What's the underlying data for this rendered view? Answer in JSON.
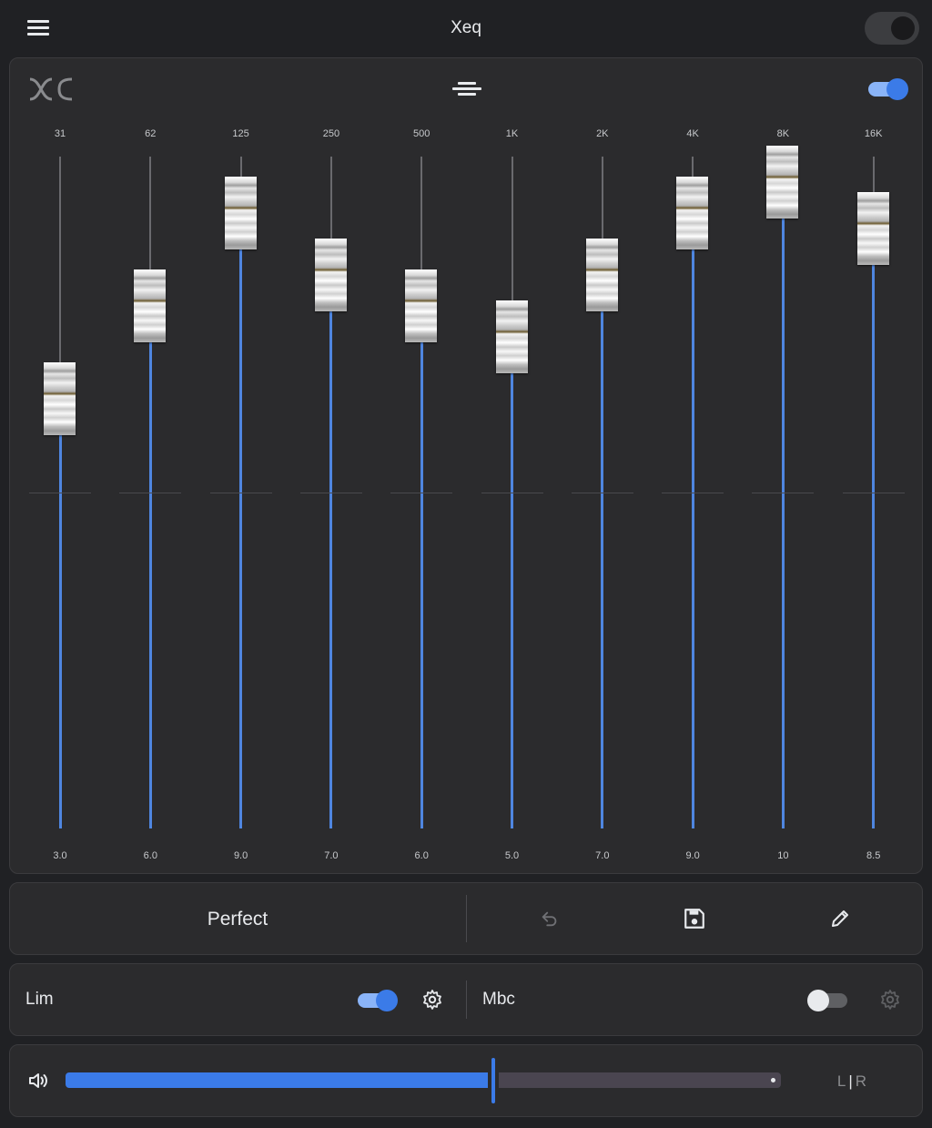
{
  "app": {
    "title": "Xeq",
    "power_on": false
  },
  "equalizer": {
    "enabled": true,
    "bands": [
      {
        "freq": "31",
        "value": "3.0"
      },
      {
        "freq": "62",
        "value": "6.0"
      },
      {
        "freq": "125",
        "value": "9.0"
      },
      {
        "freq": "250",
        "value": "7.0"
      },
      {
        "freq": "500",
        "value": "6.0"
      },
      {
        "freq": "1K",
        "value": "5.0"
      },
      {
        "freq": "2K",
        "value": "7.0"
      },
      {
        "freq": "4K",
        "value": "9.0"
      },
      {
        "freq": "8K",
        "value": "10"
      },
      {
        "freq": "16K",
        "value": "8.5"
      }
    ]
  },
  "preset": {
    "name": "Perfect"
  },
  "effects": {
    "limiter": {
      "label": "Lim",
      "enabled": true
    },
    "mbc": {
      "label": "Mbc",
      "enabled": false
    }
  },
  "volume": {
    "level": 0.6,
    "balance_label_left": "L",
    "balance_label_right": "R"
  },
  "colors": {
    "accent": "#3b7be8",
    "accent_light": "#8ab4f8",
    "background": "#202124",
    "card": "#2b2b2d"
  }
}
